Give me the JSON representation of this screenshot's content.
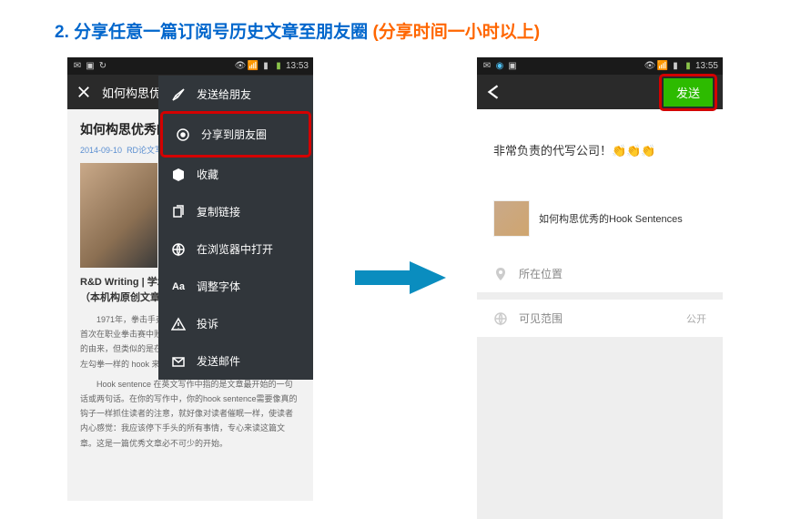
{
  "instruction": {
    "num": "2.",
    "main": "分享任意一篇订阅号历史文章至朋友圈",
    "extra": "(分享时间一小时以上)"
  },
  "statusTimeLeft": "13:53",
  "statusTimeRight": "13:55",
  "navLeft": {
    "title": "如何构思优秀的Hook Sentenc..."
  },
  "article": {
    "title": "如何构思优秀的",
    "metaDate": "2014-09-10",
    "metaSource": "RD论文写",
    "subtitle1": "R&D Writing | 学术",
    "subtitle2": "（本机构原创文章，",
    "para1": "1971年，拳击手弗雷 ... 败了当时的拳王阿里，导致阿里首次在职业拳击赛中败北。虽然这并不是写作中hook 这个词的由来，但类似的是在写作中我们同样需要像弗雷泽强大的左勾拳一样的 hook 来敲击读者的心灵，吸引读者的注意力。",
    "para2": "Hook sentence 在英文写作中指的是文章最开始的一句话或两句话。在你的写作中，你的hook sentence需要像真的钩子一样抓住读者的注意，就好像对读者催眠一样，使读者内心感觉：我应该停下手头的所有事情，专心来读这篇文章。这是一篇优秀文章必不可少的开始。"
  },
  "shareMenu": {
    "items": [
      {
        "label": "发送给朋友"
      },
      {
        "label": "分享到朋友圈"
      },
      {
        "label": "收藏"
      },
      {
        "label": "复制链接"
      },
      {
        "label": "在浏览器中打开"
      },
      {
        "label": "调整字体"
      },
      {
        "label": "投诉"
      },
      {
        "label": "发送邮件"
      }
    ]
  },
  "navRight": {
    "sendLabel": "发送"
  },
  "compose": {
    "text": "非常负责的代写公司！👏👏👏",
    "attachedTitle": "如何构思优秀的Hook Sentences",
    "location": "所在位置",
    "visibility": "可见范围",
    "visibilityValue": "公开"
  }
}
